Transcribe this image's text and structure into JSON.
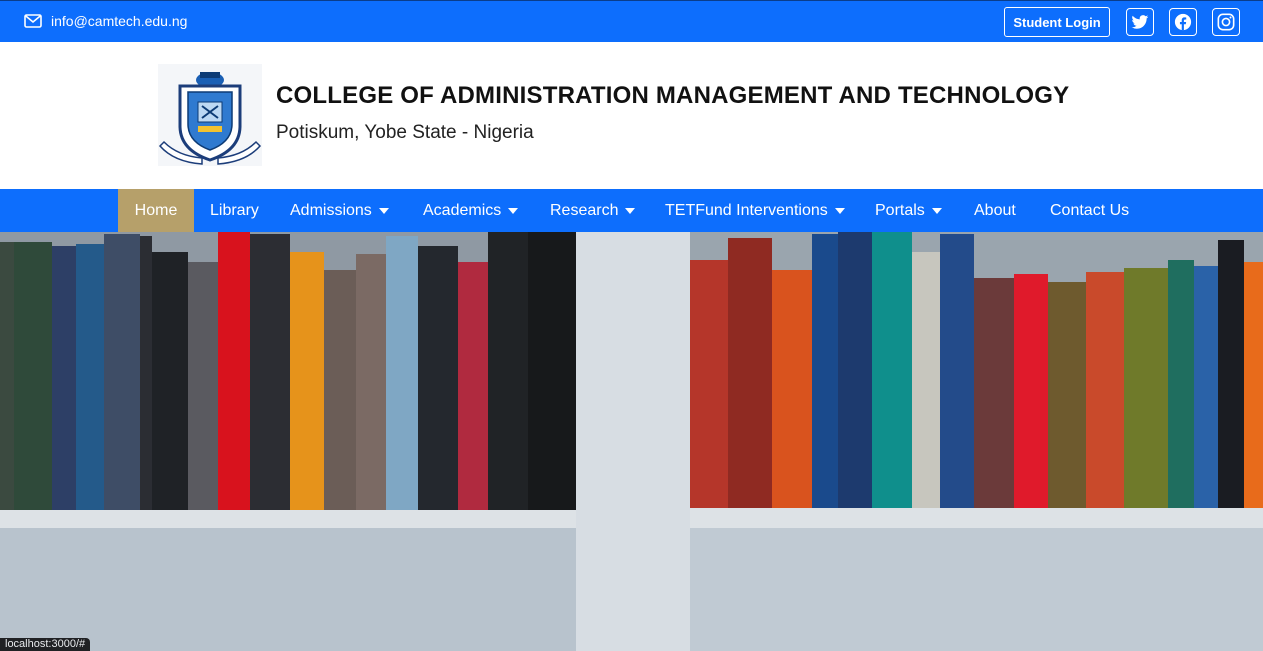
{
  "topbar": {
    "email": "info@camtech.edu.ng",
    "student_login": "Student Login",
    "social_icons": [
      "twitter-icon",
      "facebook-icon",
      "instagram-icon"
    ]
  },
  "header": {
    "college_name": "COLLEGE OF ADMINISTRATION MANAGEMENT AND TECHNOLOGY",
    "location": "Potiskum, Yobe State - Nigeria"
  },
  "nav": {
    "items": [
      {
        "label": "Home",
        "active": true
      },
      {
        "label": "Library"
      },
      {
        "label": "Admissions",
        "dropdown": true
      },
      {
        "label": "Academics",
        "dropdown": true
      },
      {
        "label": "Research",
        "dropdown": true
      },
      {
        "label": "TETFund Interventions",
        "dropdown": true
      },
      {
        "label": "Portals",
        "dropdown": true
      },
      {
        "label": "About"
      },
      {
        "label": "Contact Us"
      }
    ]
  },
  "status_bar": {
    "url": "localhost:3000/#"
  },
  "colors": {
    "primary": "#0d6efd",
    "active_nav": "#b6a06a"
  }
}
